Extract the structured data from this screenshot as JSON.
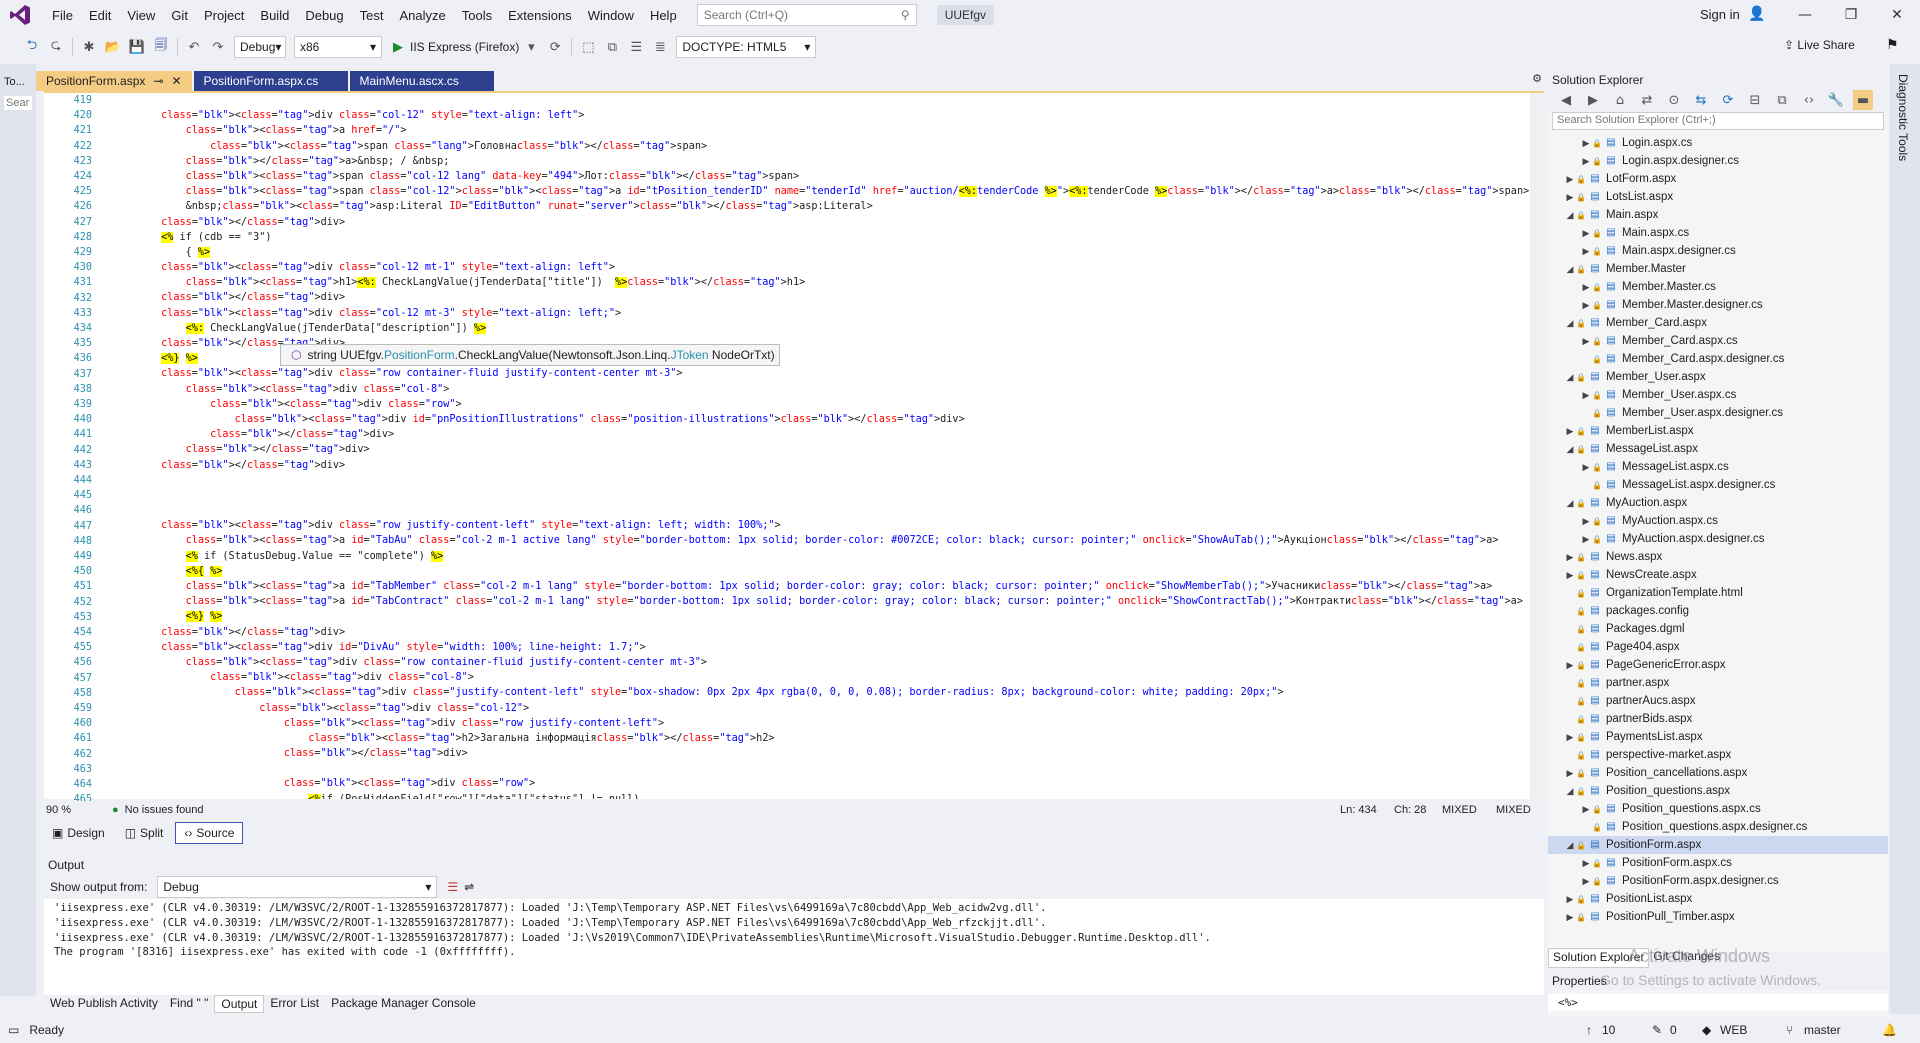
{
  "menu": {
    "items": [
      "File",
      "Edit",
      "View",
      "Git",
      "Project",
      "Build",
      "Debug",
      "Test",
      "Analyze",
      "Tools",
      "Extensions",
      "Window",
      "Help"
    ],
    "search_placeholder": "Search (Ctrl+Q)",
    "solution": "UUEfgv",
    "signin": "Sign in"
  },
  "toolbar": {
    "config": "Debug",
    "platform": "x86",
    "run": "IIS Express (Firefox)",
    "doctype": "DOCTYPE: HTML5",
    "liveshare": "Live Share"
  },
  "left_panel": {
    "label": "To...",
    "search": "Sear"
  },
  "tabs": [
    {
      "label": "PositionForm.aspx",
      "active": true
    },
    {
      "label": "PositionForm.aspx.cs",
      "active": false
    },
    {
      "label": "MainMenu.ascx.cs",
      "active": false
    }
  ],
  "code_lines": [
    {
      "n": "419",
      "t": ""
    },
    {
      "n": "420",
      "t": "        <div class=\"col-12\" style=\"text-align: left\">"
    },
    {
      "n": "421",
      "t": "            <a href=\"/\">"
    },
    {
      "n": "422",
      "t": "                <span class=\"lang\">Головна</span>"
    },
    {
      "n": "423",
      "t": "            </a>&nbsp; / &nbsp;"
    },
    {
      "n": "424",
      "t": "            <span class=\"col-12 lang\" data-key=\"494\">Лот:</span>"
    },
    {
      "n": "425",
      "t": "            <span class=\"col-12\"><a id=\"tPosition_tenderID\" name=\"tenderId\" href=\"auction/<%:tenderCode %>\"><%:tenderCode %></a></span>"
    },
    {
      "n": "426",
      "t": "            &nbsp;<asp:Literal ID=\"EditButton\" runat=\"server\"></asp:Literal>"
    },
    {
      "n": "427",
      "t": "        </div>"
    },
    {
      "n": "428",
      "t": "        <% if (cdb == \"3\")"
    },
    {
      "n": "429",
      "t": "            { %>"
    },
    {
      "n": "430",
      "t": "        <div class=\"col-12 mt-1\" style=\"text-align: left\">"
    },
    {
      "n": "431",
      "t": "            <h1><%: CheckLangValue(jTenderData[\"title\"])  %></h1>"
    },
    {
      "n": "432",
      "t": "        </div>"
    },
    {
      "n": "433",
      "t": "        <div class=\"col-12 mt-3\" style=\"text-align: left;\">"
    },
    {
      "n": "434",
      "t": "            <%: CheckLangValue(jTenderData[\"description\"]) %>"
    },
    {
      "n": "435",
      "t": "        </div>"
    },
    {
      "n": "436",
      "t": "        <%} %>"
    },
    {
      "n": "437",
      "t": "        <div class=\"row container-fluid justify-content-center mt-3\">"
    },
    {
      "n": "438",
      "t": "            <div class=\"col-8\">"
    },
    {
      "n": "439",
      "t": "                <div class=\"row\">"
    },
    {
      "n": "440",
      "t": "                    <div id=\"pnPositionIllustrations\" class=\"position-illustrations\"></div>"
    },
    {
      "n": "441",
      "t": "                </div>"
    },
    {
      "n": "442",
      "t": "            </div>"
    },
    {
      "n": "443",
      "t": "        </div>"
    },
    {
      "n": "444",
      "t": ""
    },
    {
      "n": "445",
      "t": ""
    },
    {
      "n": "446",
      "t": ""
    },
    {
      "n": "447",
      "t": "        <div class=\"row justify-content-left\" style=\"text-align: left; width: 100%;\">"
    },
    {
      "n": "448",
      "t": "            <a id=\"TabAu\" class=\"col-2 m-1 active lang\" style=\"border-bottom: 1px solid; border-color: #0072CE; color: black; cursor: pointer;\" onclick=\"ShowAuTab();\">Аукціон</a>"
    },
    {
      "n": "449",
      "t": "            <% if (StatusDebug.Value == \"complete\") %>"
    },
    {
      "n": "450",
      "t": "            <%{ %>"
    },
    {
      "n": "451",
      "t": "            <a id=\"TabMember\" class=\"col-2 m-1 lang\" style=\"border-bottom: 1px solid; border-color: gray; color: black; cursor: pointer;\" onclick=\"ShowMemberTab();\">Учасники</a>"
    },
    {
      "n": "452",
      "t": "            <a id=\"TabContract\" class=\"col-2 m-1 lang\" style=\"border-bottom: 1px solid; border-color: gray; color: black; cursor: pointer;\" onclick=\"ShowContractTab();\">Контракти</a>"
    },
    {
      "n": "453",
      "t": "            <%} %>"
    },
    {
      "n": "454",
      "t": "        </div>"
    },
    {
      "n": "455",
      "t": "        <div id=\"DivAu\" style=\"width: 100%; line-height: 1.7;\">"
    },
    {
      "n": "456",
      "t": "            <div class=\"row container-fluid justify-content-center mt-3\">"
    },
    {
      "n": "457",
      "t": "                <div class=\"col-8\">"
    },
    {
      "n": "458",
      "t": "                    <div class=\"justify-content-left\" style=\"box-shadow: 0px 2px 4px rgba(0, 0, 0, 0.08); border-radius: 8px; background-color: white; padding: 20px;\">"
    },
    {
      "n": "459",
      "t": "                        <div class=\"col-12\">"
    },
    {
      "n": "460",
      "t": "                            <div class=\"row justify-content-left\">"
    },
    {
      "n": "461",
      "t": "                                <h2>Загальна інформація</h2>"
    },
    {
      "n": "462",
      "t": "                            </div>"
    },
    {
      "n": "463",
      "t": ""
    },
    {
      "n": "464",
      "t": "                            <div class=\"row\">"
    },
    {
      "n": "465",
      "t": "                                <%if (PosHiddenField[\"row\"][\"data\"][\"status\"] != null)"
    }
  ],
  "tooltip": {
    "prefix": "string UUEfgv.",
    "class": "PositionForm",
    "method": ".CheckLangValue(",
    "type": "Newtonsoft.Json.Linq.",
    "jtoken": "JToken",
    "param": " NodeOrTxt)"
  },
  "editor_status": {
    "zoom": "90 %",
    "issues": "No issues found",
    "line": "Ln: 434",
    "col": "Ch: 28",
    "mode1": "MIXED",
    "mode2": "MIXED"
  },
  "view_tabs": [
    "Design",
    "Split",
    "Source"
  ],
  "output": {
    "title": "Output",
    "show_from_label": "Show output from:",
    "source": "Debug",
    "lines": [
      "'iisexpress.exe' (CLR v4.0.30319: /LM/W3SVC/2/ROOT-1-132855916372817877): Loaded 'J:\\Temp\\Temporary ASP.NET Files\\vs\\6499169a\\7c80cbdd\\App_Web_acidw2vg.dll'.",
      "'iisexpress.exe' (CLR v4.0.30319: /LM/W3SVC/2/ROOT-1-132855916372817877): Loaded 'J:\\Temp\\Temporary ASP.NET Files\\vs\\6499169a\\7c80cbdd\\App_Web_rfzckjjt.dll'.",
      "'iisexpress.exe' (CLR v4.0.30319: /LM/W3SVC/2/ROOT-1-132855916372817877): Loaded 'J:\\Vs2019\\Common7\\IDE\\PrivateAssemblies\\Runtime\\Microsoft.VisualStudio.Debugger.Runtime.Desktop.dll'.",
      "The program '[8316] iisexpress.exe' has exited with code -1 (0xffffffff)."
    ]
  },
  "bottom_tabs": [
    "Web Publish Activity",
    "Find \" \"",
    "Output",
    "Error List",
    "Package Manager Console"
  ],
  "status": {
    "ready": "Ready",
    "errors": "10",
    "edits": "0",
    "repo": "WEB",
    "branch": "master",
    "notif": "1"
  },
  "solution_explorer": {
    "title": "Solution Explorer",
    "search": "Search Solution Explorer (Ctrl+;)",
    "items": [
      {
        "d": 2,
        "e": "▶",
        "n": "Login.aspx.cs"
      },
      {
        "d": 2,
        "e": "▶",
        "n": "Login.aspx.designer.cs"
      },
      {
        "d": 1,
        "e": "▶",
        "n": "LotForm.aspx"
      },
      {
        "d": 1,
        "e": "▶",
        "n": "LotsList.aspx"
      },
      {
        "d": 1,
        "e": "◢",
        "n": "Main.aspx"
      },
      {
        "d": 2,
        "e": "▶",
        "n": "Main.aspx.cs"
      },
      {
        "d": 2,
        "e": "▶",
        "n": "Main.aspx.designer.cs"
      },
      {
        "d": 1,
        "e": "◢",
        "n": "Member.Master"
      },
      {
        "d": 2,
        "e": "▶",
        "n": "Member.Master.cs"
      },
      {
        "d": 2,
        "e": "▶",
        "n": "Member.Master.designer.cs"
      },
      {
        "d": 1,
        "e": "◢",
        "n": "Member_Card.aspx"
      },
      {
        "d": 2,
        "e": "▶",
        "n": "Member_Card.aspx.cs"
      },
      {
        "d": 2,
        "e": "",
        "n": "Member_Card.aspx.designer.cs"
      },
      {
        "d": 1,
        "e": "◢",
        "n": "Member_User.aspx"
      },
      {
        "d": 2,
        "e": "▶",
        "n": "Member_User.aspx.cs"
      },
      {
        "d": 2,
        "e": "",
        "n": "Member_User.aspx.designer.cs"
      },
      {
        "d": 1,
        "e": "▶",
        "n": "MemberList.aspx"
      },
      {
        "d": 1,
        "e": "◢",
        "n": "MessageList.aspx"
      },
      {
        "d": 2,
        "e": "▶",
        "n": "MessageList.aspx.cs"
      },
      {
        "d": 2,
        "e": "",
        "n": "MessageList.aspx.designer.cs"
      },
      {
        "d": 1,
        "e": "◢",
        "n": "MyAuction.aspx"
      },
      {
        "d": 2,
        "e": "▶",
        "n": "MyAuction.aspx.cs"
      },
      {
        "d": 2,
        "e": "▶",
        "n": "MyAuction.aspx.designer.cs"
      },
      {
        "d": 1,
        "e": "▶",
        "n": "News.aspx"
      },
      {
        "d": 1,
        "e": "▶",
        "n": "NewsCreate.aspx"
      },
      {
        "d": 1,
        "e": "",
        "n": "OrganizationTemplate.html"
      },
      {
        "d": 1,
        "e": "",
        "n": "packages.config"
      },
      {
        "d": 1,
        "e": "",
        "n": "Packages.dgml"
      },
      {
        "d": 1,
        "e": "",
        "n": "Page404.aspx"
      },
      {
        "d": 1,
        "e": "▶",
        "n": "PageGenericError.aspx"
      },
      {
        "d": 1,
        "e": "",
        "n": "partner.aspx"
      },
      {
        "d": 1,
        "e": "",
        "n": "partnerAucs.aspx"
      },
      {
        "d": 1,
        "e": "",
        "n": "partnerBids.aspx"
      },
      {
        "d": 1,
        "e": "▶",
        "n": "PaymentsList.aspx"
      },
      {
        "d": 1,
        "e": "",
        "n": "perspective-market.aspx"
      },
      {
        "d": 1,
        "e": "▶",
        "n": "Position_cancellations.aspx"
      },
      {
        "d": 1,
        "e": "◢",
        "n": "Position_questions.aspx"
      },
      {
        "d": 2,
        "e": "▶",
        "n": "Position_questions.aspx.cs"
      },
      {
        "d": 2,
        "e": "",
        "n": "Position_questions.aspx.designer.cs"
      },
      {
        "d": 1,
        "e": "◢",
        "n": "PositionForm.aspx",
        "sel": true
      },
      {
        "d": 2,
        "e": "▶",
        "n": "PositionForm.aspx.cs"
      },
      {
        "d": 2,
        "e": "▶",
        "n": "PositionForm.aspx.designer.cs"
      },
      {
        "d": 1,
        "e": "▶",
        "n": "PositionList.aspx"
      },
      {
        "d": 1,
        "e": "▶",
        "n": "PositionPull_Timber.aspx"
      }
    ],
    "tabs": [
      "Solution Explorer",
      "Git Changes"
    ]
  },
  "properties": {
    "title": "Properties",
    "value": "<%>"
  },
  "right_strip": {
    "label": "Diagnostic Tools"
  },
  "watermark": {
    "line1": "Activate Windows",
    "line2": "Go to Settings to activate Windows."
  }
}
